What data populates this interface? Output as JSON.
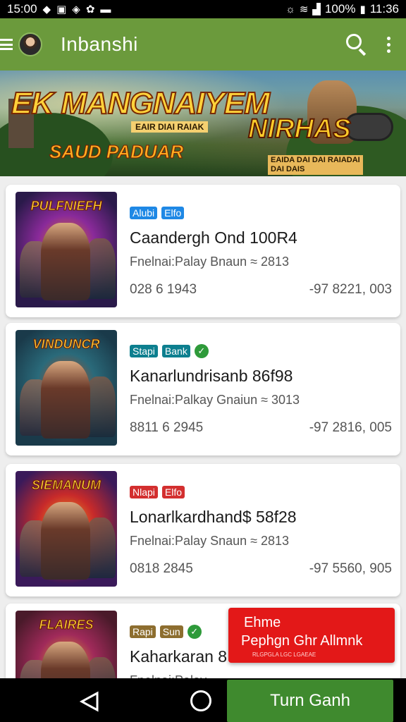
{
  "status_bar": {
    "time_left": "15:00",
    "battery": "100%",
    "time_right": "11:36"
  },
  "app_bar": {
    "title": "Inbanshi",
    "icons": [
      "menu-icon",
      "avatar",
      "search-icon",
      "more-vert-icon"
    ]
  },
  "banner": {
    "title_left": "EK MANGNAIYEM",
    "title_sub": "EAIR DIAI RAIAK",
    "tagline": "SAUD PADUAR",
    "title_right": "NIRHAS",
    "right_sub_1": "EAIDA DAI DAI RAIADAI",
    "right_sub_2": "DAI DAIS"
  },
  "items": [
    {
      "thumb_title": "PULFNIEFH",
      "badges": [
        {
          "label": "Alubi",
          "color": "#1e88e5"
        },
        {
          "label": "Elfo",
          "color": "#1e88e5"
        }
      ],
      "check": false,
      "title": "Caandergh Ond 100R4",
      "subtitle": "Fnelnai:Palay Bnaun ≈ 2813",
      "stat_left": "028 6 1943",
      "stat_right": "-97 8221, 003",
      "thumb_colors": [
        "#2a1a4a",
        "#8a2a9a",
        "#e07a20"
      ]
    },
    {
      "thumb_title": "VINDUNCR",
      "badges": [
        {
          "label": "Stapi",
          "color": "#0d7f8f"
        },
        {
          "label": "Bank",
          "color": "#0d7f8f"
        }
      ],
      "check": true,
      "title": "Kanarlundrisanb 86f98",
      "subtitle": "Fnelnai:Palkay Gnaiun ≈ 3013",
      "stat_left": "8811 6 2945",
      "stat_right": "-97 2816, 005",
      "thumb_colors": [
        "#1a3a4a",
        "#2a6a7a",
        "#c84a1a"
      ]
    },
    {
      "thumb_title": "SIEMANUM",
      "badges": [
        {
          "label": "Nlapi",
          "color": "#d32f2f"
        },
        {
          "label": "Elfo",
          "color": "#d32f2f"
        }
      ],
      "check": false,
      "title": "Lonarlkardhand$ 58f28",
      "subtitle": "Fnelnai:Palay Snaun ≈ 2813",
      "stat_left": "0818 2845",
      "stat_right": "-97 5560, 905",
      "thumb_colors": [
        "#3a1a5a",
        "#c82a2a",
        "#f0a020"
      ]
    },
    {
      "thumb_title": "FLAIRES",
      "badges": [
        {
          "label": "Rapi",
          "color": "#8d6e2f"
        },
        {
          "label": "Sun",
          "color": "#8d6e2f"
        }
      ],
      "check": true,
      "title": "Kaharkaran 8",
      "subtitle": "Fnelnai:Palay",
      "stat_left": "",
      "stat_right": "",
      "thumb_colors": [
        "#4a1a2a",
        "#a02a5a",
        "#e0a030"
      ]
    }
  ],
  "promo": {
    "line1": "Ehme",
    "line2": "Pephgn Ghr Allmnk",
    "line3": "RLGPGLA LGC LGAEAE"
  },
  "nav": {
    "cta_label": "Turn Ganh"
  }
}
